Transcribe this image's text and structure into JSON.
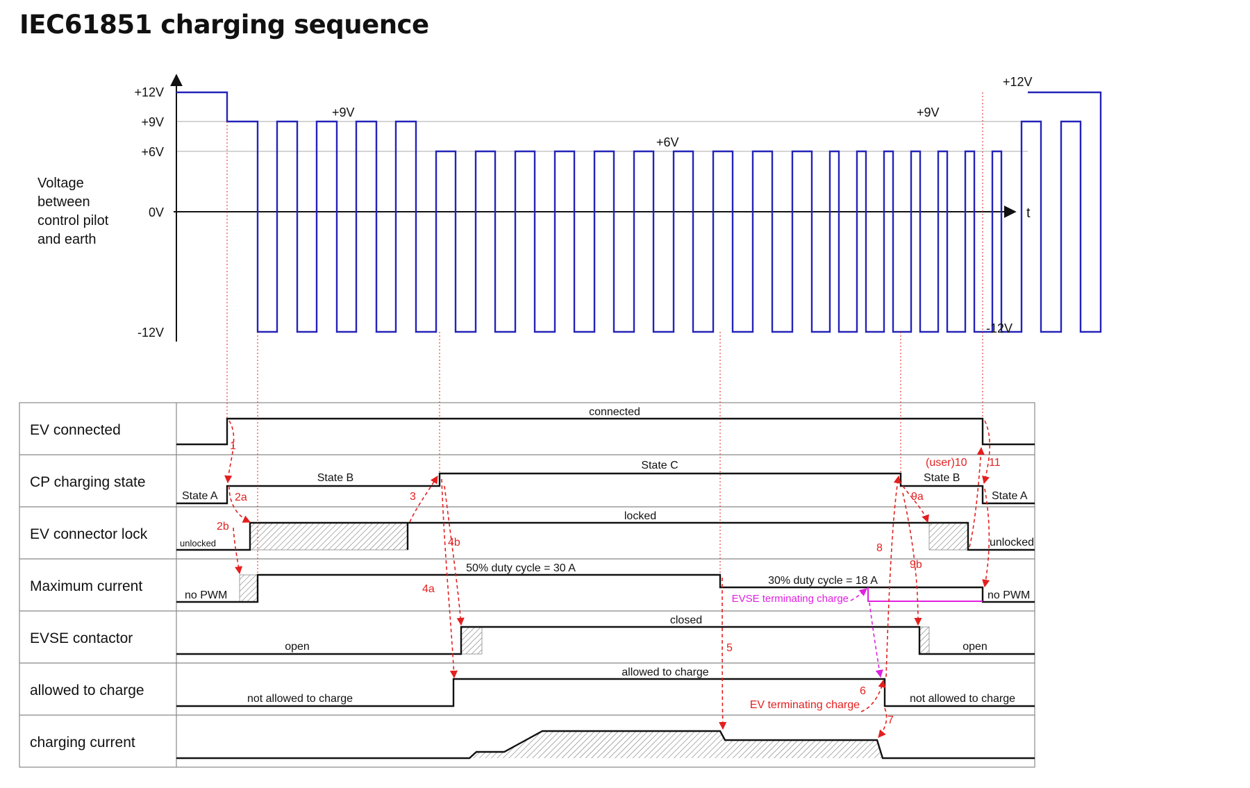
{
  "title": "IEC61851 charging sequence",
  "colors": {
    "signal": "#2323b8",
    "marker": "#e41f1f",
    "evse_marker": "#e020e0",
    "grid": "#999999",
    "trace": "#111111"
  },
  "voltage_plot": {
    "y_axis_label": [
      "Voltage",
      "between",
      "control pilot",
      "and earth"
    ],
    "x_axis_label": "t",
    "ticks": [
      "+12V",
      "+9V",
      "+6V",
      "0V",
      "-12V"
    ],
    "annotations": {
      "plus9_left": "+9V",
      "plus6": "+6V",
      "plus9_right": "+9V",
      "plus12_right": "+12V",
      "minus12_right": "-12V"
    }
  },
  "rows": [
    {
      "label": "EV connected",
      "texts": {
        "connected": "connected"
      }
    },
    {
      "label": "CP charging state",
      "texts": {
        "state_a_left": "State A",
        "state_b": "State B",
        "state_c": "State C",
        "state_b_right": "State B",
        "state_a_right": "State A"
      }
    },
    {
      "label": "EV connector lock",
      "texts": {
        "unlocked_left": "unlocked",
        "locked": "locked",
        "unlocked_right": "unlocked"
      }
    },
    {
      "label": "Maximum current",
      "texts": {
        "no_pwm_left": "no PWM",
        "duty50": "50% duty cycle = 30 A",
        "duty30": "30% duty cycle = 18 A",
        "no_pwm_right": "no PWM"
      }
    },
    {
      "label": "EVSE contactor",
      "texts": {
        "open_left": "open",
        "closed": "closed",
        "open_right": "open"
      }
    },
    {
      "label": "allowed to charge",
      "texts": {
        "not_allowed_left": "not allowed to charge",
        "allowed": "allowed to charge",
        "not_allowed_right": "not allowed to charge"
      }
    },
    {
      "label": "charging current",
      "texts": {}
    }
  ],
  "sequence_markers": [
    "1",
    "2a",
    "2b",
    "3",
    "4a",
    "4b",
    "5",
    "6",
    "7",
    "8",
    "9a",
    "9b",
    "(user)10",
    "11"
  ],
  "callouts": {
    "evse_terminating": "EVSE terminating charge",
    "ev_terminating": "EV terminating charge"
  }
}
